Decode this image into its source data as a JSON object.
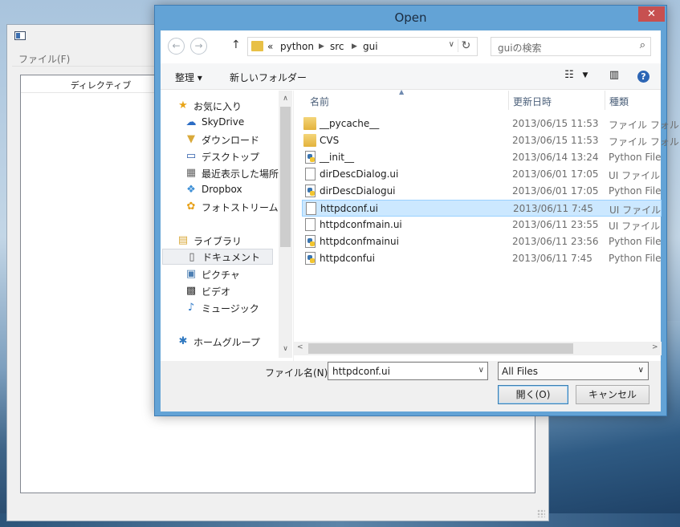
{
  "background_window": {
    "menu": "ファイル(F)",
    "column_header": "ディレクティブ"
  },
  "dialog": {
    "title": "Open",
    "close": "✕",
    "nav": {
      "back": "←",
      "forward": "→",
      "up": "↑"
    },
    "breadcrumb": [
      "«",
      "python",
      "src",
      "gui"
    ],
    "search_placeholder": "guiの検索",
    "toolbar": {
      "organize": "整理 ▾",
      "new_folder": "新しいフォルダー"
    },
    "nav_pane": [
      {
        "label": "お気に入り",
        "icon": "star-icon"
      },
      {
        "label": "SkyDrive",
        "icon": "cloud-icon"
      },
      {
        "label": "ダウンロード",
        "icon": "download-folder-icon"
      },
      {
        "label": "デスクトップ",
        "icon": "desktop-icon"
      },
      {
        "label": "最近表示した場所",
        "icon": "recent-places-icon"
      },
      {
        "label": "Dropbox",
        "icon": "dropbox-icon"
      },
      {
        "label": "フォトストリーム",
        "icon": "photostream-icon"
      },
      {
        "label": "ライブラリ",
        "icon": "libraries-icon"
      },
      {
        "label": "ドキュメント",
        "icon": "documents-icon"
      },
      {
        "label": "ピクチャ",
        "icon": "pictures-icon"
      },
      {
        "label": "ビデオ",
        "icon": "videos-icon"
      },
      {
        "label": "ミュージック",
        "icon": "music-icon"
      },
      {
        "label": "ホームグループ",
        "icon": "homegroup-icon"
      }
    ],
    "columns": {
      "name": "名前",
      "date": "更新日時",
      "type": "種類"
    },
    "files": [
      {
        "name": "__pycache__",
        "date": "2013/06/15 11:53",
        "type": "ファイル フォル",
        "icon": "folder"
      },
      {
        "name": "CVS",
        "date": "2013/06/15 11:53",
        "type": "ファイル フォル",
        "icon": "folder"
      },
      {
        "name": "__init__",
        "date": "2013/06/14 13:24",
        "type": "Python File",
        "icon": "python"
      },
      {
        "name": "dirDescDialog.ui",
        "date": "2013/06/01 17:05",
        "type": "UI ファイル",
        "icon": "document"
      },
      {
        "name": "dirDescDialogui",
        "date": "2013/06/01 17:05",
        "type": "Python File",
        "icon": "python"
      },
      {
        "name": "httpdconf.ui",
        "date": "2013/06/11 7:45",
        "type": "UI ファイル",
        "icon": "document"
      },
      {
        "name": "httpdconfmain.ui",
        "date": "2013/06/11 23:55",
        "type": "UI ファイル",
        "icon": "document"
      },
      {
        "name": "httpdconfmainui",
        "date": "2013/06/11 23:56",
        "type": "Python File",
        "icon": "python"
      },
      {
        "name": "httpdconfui",
        "date": "2013/06/11 7:45",
        "type": "Python File",
        "icon": "python"
      }
    ],
    "selected_file": "httpdconf.ui",
    "filename_label": "ファイル名(N):",
    "filename_value": "httpdconf.ui",
    "filter_value": "All Files",
    "open_button": "開く(O)",
    "cancel_button": "キャンセル"
  }
}
